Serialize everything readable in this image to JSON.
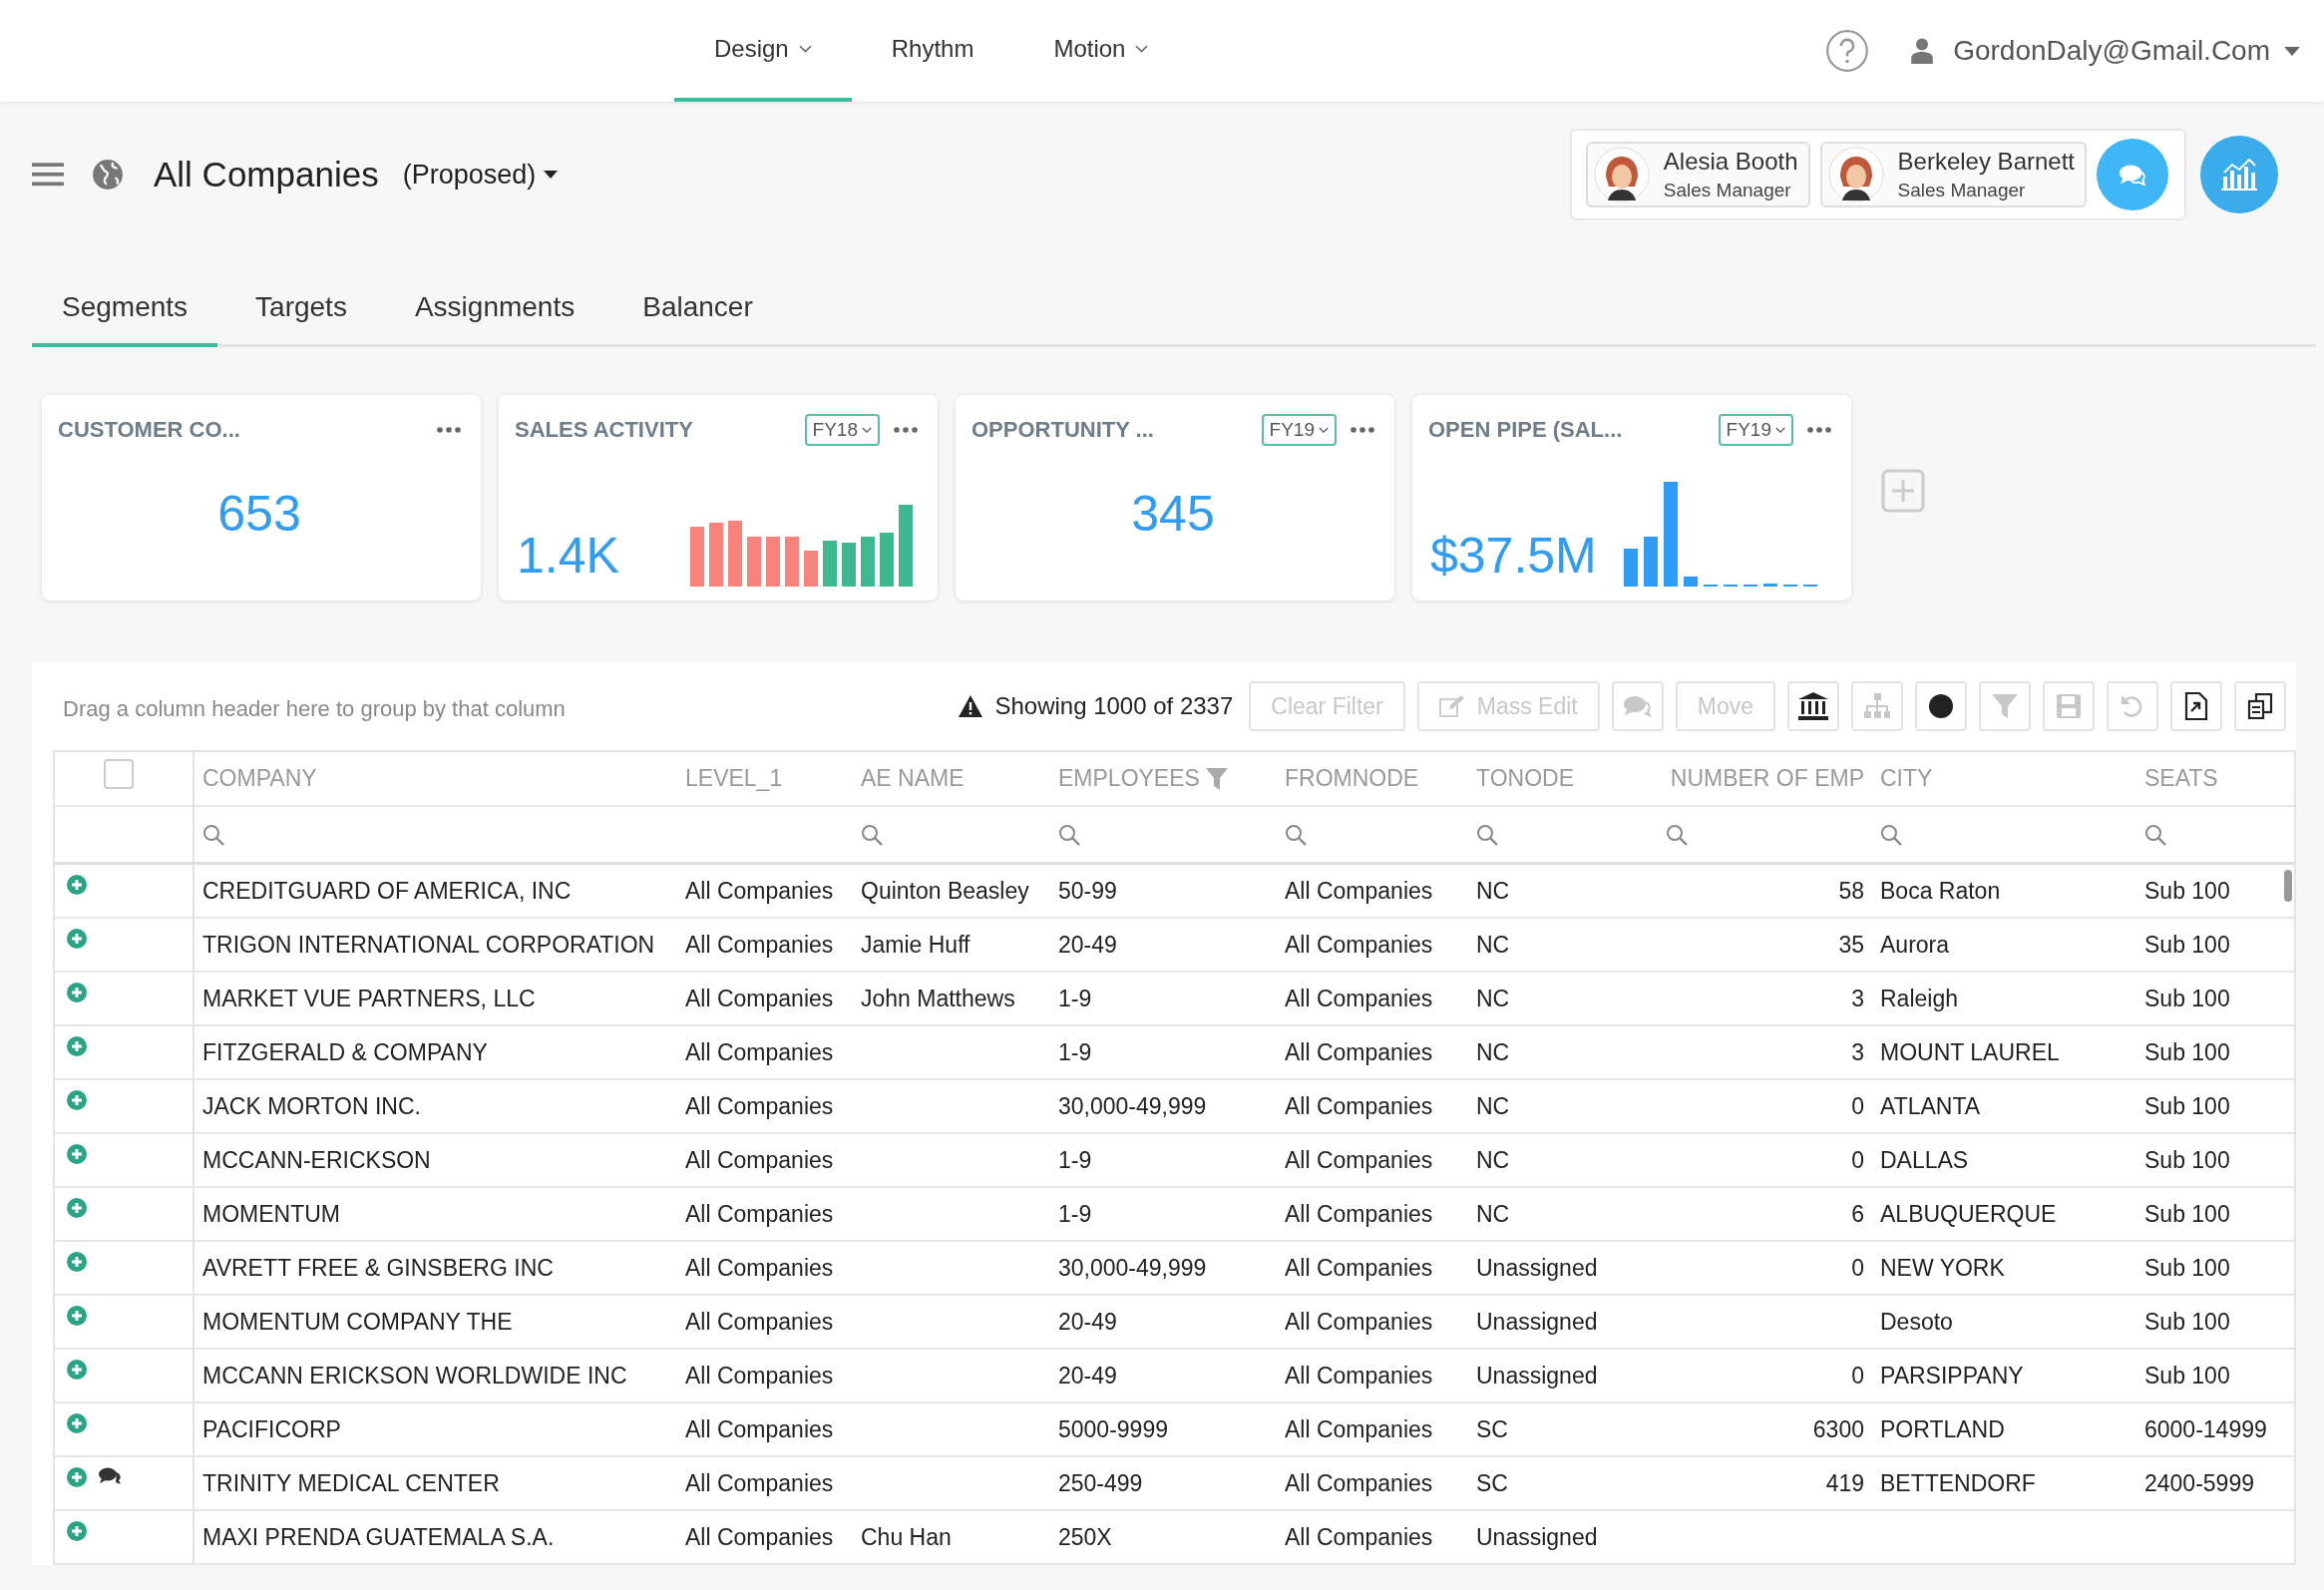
{
  "top_nav": {
    "items": [
      {
        "label": "Design",
        "selected": true,
        "has_menu": true
      },
      {
        "label": "Rhythm",
        "selected": false,
        "has_menu": false
      },
      {
        "label": "Motion",
        "selected": false,
        "has_menu": true
      }
    ],
    "user": "GordonDaly@Gmail.Com"
  },
  "header": {
    "title": "All Companies",
    "scenario": "(Proposed)",
    "people": [
      {
        "name": "Alesia Booth",
        "role": "Sales Manager"
      },
      {
        "name": "Berkeley Barnett",
        "role": "Sales Manager"
      }
    ]
  },
  "tabs": [
    {
      "label": "Segments",
      "selected": true
    },
    {
      "label": "Targets",
      "selected": false
    },
    {
      "label": "Assignments",
      "selected": false
    },
    {
      "label": "Balancer",
      "selected": false
    }
  ],
  "cards": [
    {
      "title": "CUSTOMER CO...",
      "value": "653",
      "kind": "number"
    },
    {
      "title": "SALES ACTIVITY",
      "badge": "FY18",
      "value": "1.4K",
      "kind": "activity"
    },
    {
      "title": "OPPORTUNITY ...",
      "badge": "FY19",
      "value": "345",
      "kind": "number"
    },
    {
      "title": "OPEN PIPE (SAL...",
      "badge": "FY19",
      "value": "$37.5M",
      "kind": "pipe"
    }
  ],
  "toolbar": {
    "hint": "Drag a column header here to group by that column",
    "status": "Showing 1000 of 2337",
    "buttons": [
      {
        "kind": "text",
        "label": "Clear Filter",
        "disabled": true
      },
      {
        "kind": "edit",
        "label": "Mass Edit",
        "disabled": true
      },
      {
        "kind": "chat",
        "disabled": true
      },
      {
        "kind": "text",
        "label": "Move",
        "disabled": true
      },
      {
        "kind": "bank",
        "disabled": false
      },
      {
        "kind": "hierarchy",
        "disabled": true
      },
      {
        "kind": "circle",
        "disabled": false
      },
      {
        "kind": "funnel",
        "disabled": true
      },
      {
        "kind": "save",
        "disabled": true
      },
      {
        "kind": "undo",
        "disabled": true
      },
      {
        "kind": "export",
        "disabled": false
      },
      {
        "kind": "copy",
        "disabled": false
      }
    ]
  },
  "table": {
    "select_all": {
      "checked": false
    },
    "columns": [
      {
        "label": "COMPANY",
        "searchable": true,
        "filtered": false,
        "numeric": false
      },
      {
        "label": "LEVEL_1",
        "searchable": false,
        "filtered": false,
        "numeric": false
      },
      {
        "label": "AE NAME",
        "searchable": true,
        "filtered": false,
        "numeric": false
      },
      {
        "label": "EMPLOYEES",
        "searchable": true,
        "filtered": true,
        "numeric": false
      },
      {
        "label": "FROMNODE",
        "searchable": true,
        "filtered": false,
        "numeric": false
      },
      {
        "label": "TONODE",
        "searchable": true,
        "filtered": false,
        "numeric": false
      },
      {
        "label": "NUMBER OF EMP",
        "searchable": true,
        "filtered": false,
        "numeric": true
      },
      {
        "label": "CITY",
        "searchable": true,
        "filtered": false,
        "numeric": false
      },
      {
        "label": "SEATS",
        "searchable": true,
        "filtered": false,
        "numeric": false
      }
    ],
    "rows": [
      {
        "has_note": false,
        "cells": [
          "CREDITGUARD OF AMERICA, INC",
          "All Companies",
          "Quinton Beasley",
          "50-99",
          "All Companies",
          "NC",
          "58",
          "Boca Raton",
          "Sub 100"
        ]
      },
      {
        "has_note": false,
        "cells": [
          "TRIGON INTERNATIONAL CORPORATION",
          "All Companies",
          "Jamie Huff",
          "20-49",
          "All Companies",
          "NC",
          "35",
          "Aurora",
          "Sub 100"
        ]
      },
      {
        "has_note": false,
        "cells": [
          "MARKET VUE PARTNERS, LLC",
          "All Companies",
          "John Matthews",
          "1-9",
          "All Companies",
          "NC",
          "3",
          "Raleigh",
          "Sub 100"
        ]
      },
      {
        "has_note": false,
        "cells": [
          "FITZGERALD & COMPANY",
          "All Companies",
          null,
          "1-9",
          "All Companies",
          "NC",
          "3",
          "MOUNT LAUREL",
          "Sub 100"
        ]
      },
      {
        "has_note": false,
        "cells": [
          "JACK MORTON INC.",
          "All Companies",
          null,
          "30,000-49,999",
          "All Companies",
          "NC",
          "0",
          "ATLANTA",
          "Sub 100"
        ]
      },
      {
        "has_note": false,
        "cells": [
          "MCCANN-ERICKSON",
          "All Companies",
          null,
          "1-9",
          "All Companies",
          "NC",
          "0",
          "DALLAS",
          "Sub 100"
        ]
      },
      {
        "has_note": false,
        "cells": [
          "MOMENTUM",
          "All Companies",
          null,
          "1-9",
          "All Companies",
          "NC",
          "6",
          "ALBUQUERQUE",
          "Sub 100"
        ]
      },
      {
        "has_note": false,
        "cells": [
          "AVRETT FREE & GINSBERG INC",
          "All Companies",
          null,
          "30,000-49,999",
          "All Companies",
          "Unassigned",
          "0",
          "NEW YORK",
          "Sub 100"
        ]
      },
      {
        "has_note": false,
        "cells": [
          "MOMENTUM COMPANY THE",
          "All Companies",
          null,
          "20-49",
          "All Companies",
          "Unassigned",
          null,
          "Desoto",
          "Sub 100"
        ]
      },
      {
        "has_note": false,
        "cells": [
          "MCCANN ERICKSON WORLDWIDE INC",
          "All Companies",
          null,
          "20-49",
          "All Companies",
          "Unassigned",
          "0",
          "PARSIPPANY",
          "Sub 100"
        ]
      },
      {
        "has_note": false,
        "cells": [
          "PACIFICORP",
          "All Companies",
          null,
          "5000-9999",
          "All Companies",
          "SC",
          "6300",
          "PORTLAND",
          "6000-14999"
        ]
      },
      {
        "has_note": true,
        "cells": [
          "TRINITY MEDICAL CENTER",
          "All Companies",
          null,
          "250-499",
          "All Companies",
          "SC",
          "419",
          "BETTENDORF",
          "2400-5999"
        ]
      },
      {
        "has_note": false,
        "cells": [
          "MAXI PRENDA GUATEMALA S.A.",
          "All Companies",
          "Chu Han",
          "250X",
          "All Companies",
          "Unassigned",
          null,
          null,
          null
        ]
      }
    ]
  }
}
